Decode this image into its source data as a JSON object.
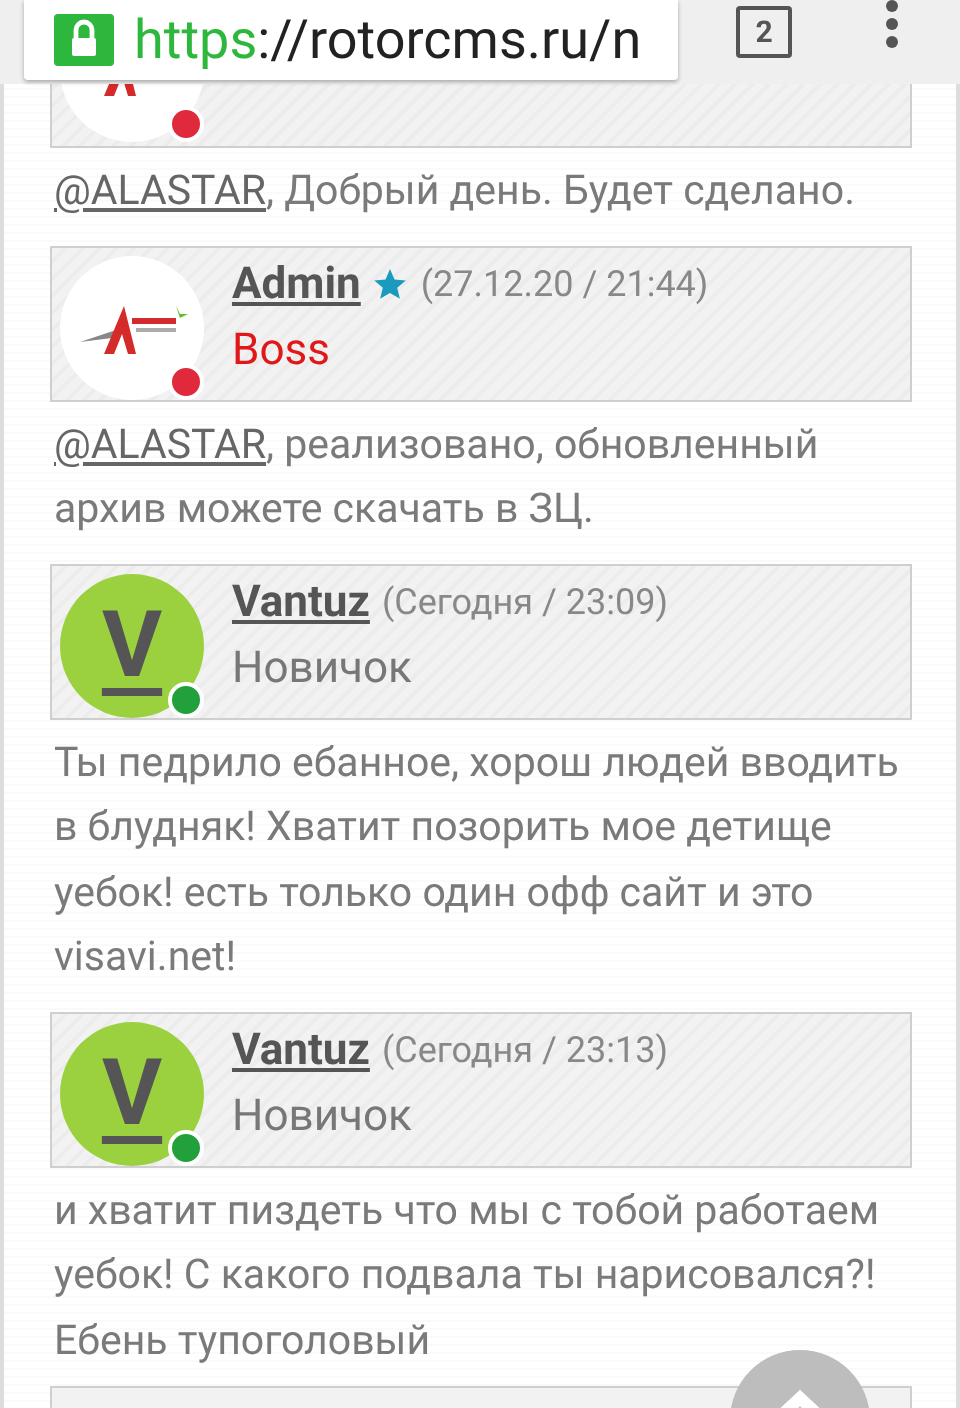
{
  "browser": {
    "url_scheme": "https",
    "url_rest": "://rotorcms.ru/n",
    "tab_count": "2"
  },
  "posts": [
    {
      "header": {
        "kind": "admin",
        "color": "#e0293a",
        "starred": false
      },
      "message": {
        "mention": "@ALASTAR",
        "text": ", Добрый день. Будет сделано."
      }
    },
    {
      "header": {
        "kind": "admin",
        "color": "#e0293a",
        "name": "Admin",
        "starred": true,
        "date": "(27.12.20 / 21:44)",
        "rank": "Boss"
      },
      "message": {
        "mention": "@ALASTAR",
        "text": ", реализовано, обновленный архив можете скачать в ЗЦ."
      }
    },
    {
      "header": {
        "kind": "user",
        "letter": "V",
        "color": "#22a03c",
        "name": "Vantuz",
        "starred": false,
        "date": "(Сегодня / 23:09)",
        "rank": "Новичок"
      },
      "message": {
        "text": "Ты педрило ебанное, хорош людей вводить в блудняк! Хватит позорить мое детище уебок! есть только один офф сайт и это visavi.net!"
      }
    },
    {
      "header": {
        "kind": "user",
        "letter": "V",
        "color": "#22a03c",
        "name": "Vantuz",
        "starred": false,
        "date": "(Сегодня / 23:13)",
        "rank": "Новичок"
      },
      "message": {
        "text": "и хватит пиздеть что мы с тобой работаем уебок! С какого подвала ты нарисовался?! Ебень тупоголовый"
      }
    }
  ]
}
